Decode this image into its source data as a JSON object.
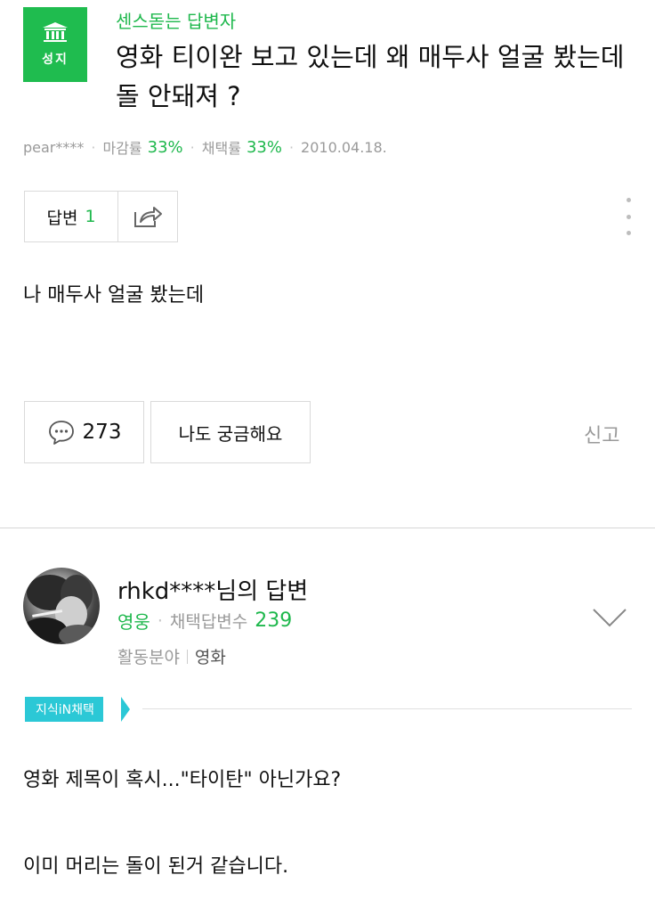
{
  "question": {
    "badge_label": "성지",
    "category": "센스돋는 답변자",
    "title": "영화 티이완 보고 있는데 왜 매두사 얼굴 봤는데 돌 안돼져 ?",
    "author": "pear****",
    "close_rate_label": "마감률",
    "close_rate": "33%",
    "adopt_rate_label": "채택률",
    "adopt_rate": "33%",
    "date": "2010.04.18.",
    "body": "나 매두사 얼굴 봤는데"
  },
  "toolbar": {
    "answers_label": "답변",
    "answers_count": "1",
    "comment_count": "273",
    "curious_label": "나도 궁금해요",
    "report_label": "신고"
  },
  "answer": {
    "author": "rhkd****님의 답변",
    "rank": "영웅",
    "adopted_label": "채택답변수",
    "adopted_count": "239",
    "field_label": "활동분야",
    "field_value": "영화",
    "tag": "지식iN채택",
    "line1": "영화 제목이 혹시...\"타이탄\" 아닌가요?",
    "line2": "이미 머리는 돌이 된거 같습니다."
  },
  "icons": {
    "badge": "pillar-building-icon",
    "share": "share-icon",
    "more": "more-vertical-icon",
    "comment": "speech-bubble-icon",
    "expand": "chevron-down-icon"
  },
  "colors": {
    "brand_green": "#1fbc4f",
    "tag_cyan": "#2bc8d6"
  }
}
